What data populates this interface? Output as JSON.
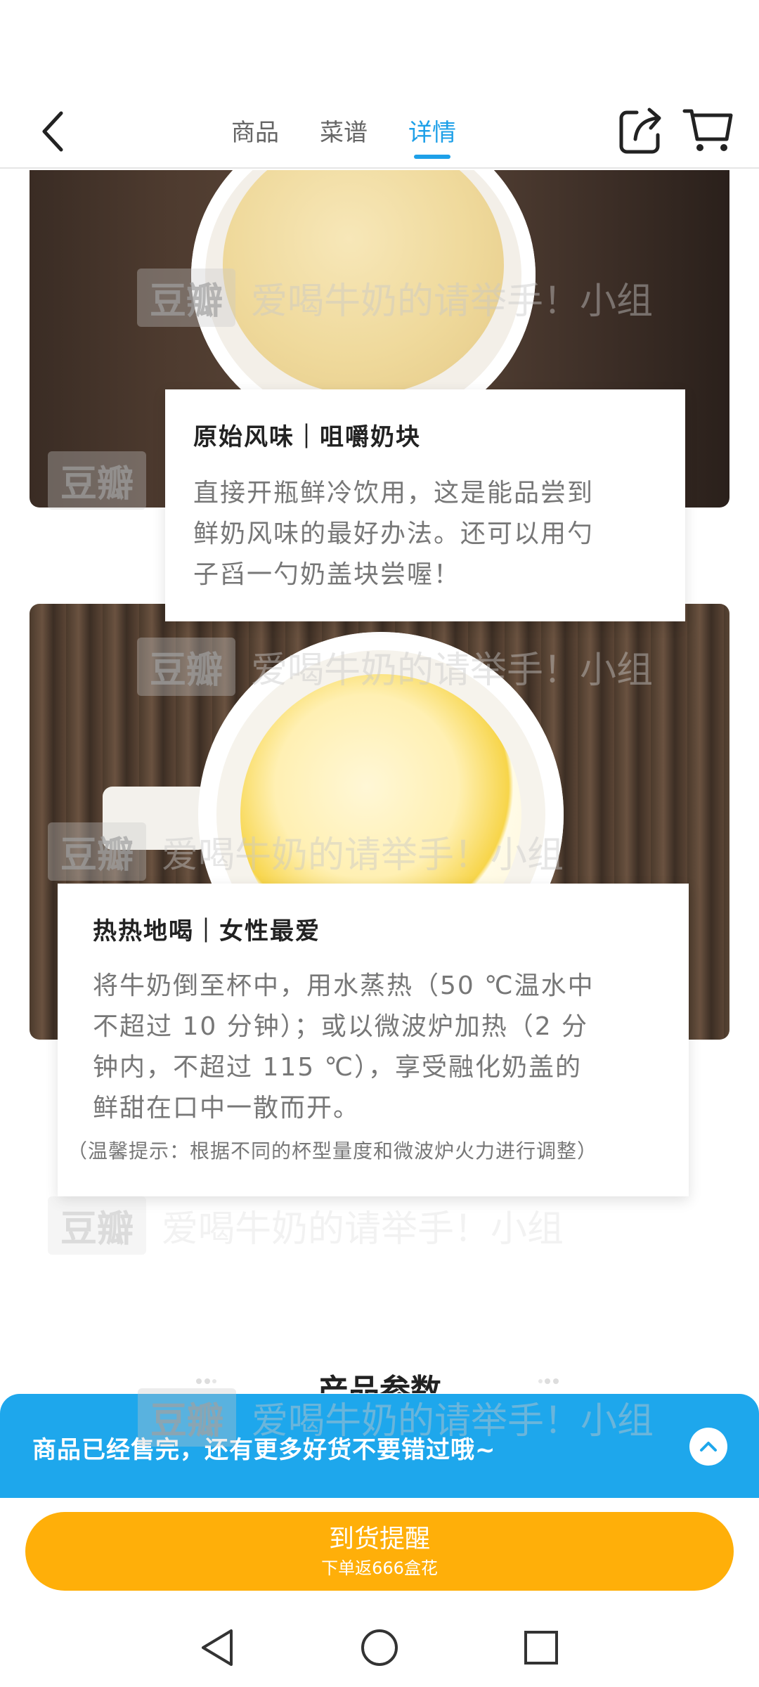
{
  "nav": {
    "tabs": [
      {
        "label": "商品",
        "active": false
      },
      {
        "label": "菜谱",
        "active": false
      },
      {
        "label": "详情",
        "active": true
      }
    ],
    "icons": {
      "back": "back-arrow-icon",
      "share": "share-icon",
      "cart": "cart-icon"
    }
  },
  "watermark": {
    "logo": "豆瓣",
    "text": "爱喝牛奶的请举手！小组"
  },
  "cards": [
    {
      "title": "原始风味｜咀嚼奶块",
      "lines": [
        "直接开瓶鲜冷饮用，这是能品尝到",
        "鲜奶风味的最好办法。还可以用勺",
        "子舀一勺奶盖块尝喔！"
      ]
    },
    {
      "title": "热热地喝｜女性最爱",
      "lines": [
        "将牛奶倒至杯中，用水蒸热（50 ℃温水中",
        "不超过 10 分钟）；或以微波炉加热（2 分",
        "钟内，不超过 115 ℃），享受融化奶盖的",
        "鲜甜在口中一散而开。"
      ],
      "note": "（温馨提示：根据不同的杯型量度和微波炉火力进行调整）"
    }
  ],
  "section": {
    "title": "产品参数"
  },
  "sold_banner": {
    "text": "商品已经售完，还有更多好货不要错过哦~",
    "icon": "chevron-up-icon"
  },
  "notify_button": {
    "label": "到货提醒",
    "sub": "下单返666盒花"
  },
  "system_nav": {
    "icons": [
      "nav-back-icon",
      "nav-home-icon",
      "nav-recents-icon"
    ]
  },
  "colors": {
    "accent": "#1ea0e8",
    "banner": "#1ea7ec",
    "button": "#ffaf09"
  }
}
